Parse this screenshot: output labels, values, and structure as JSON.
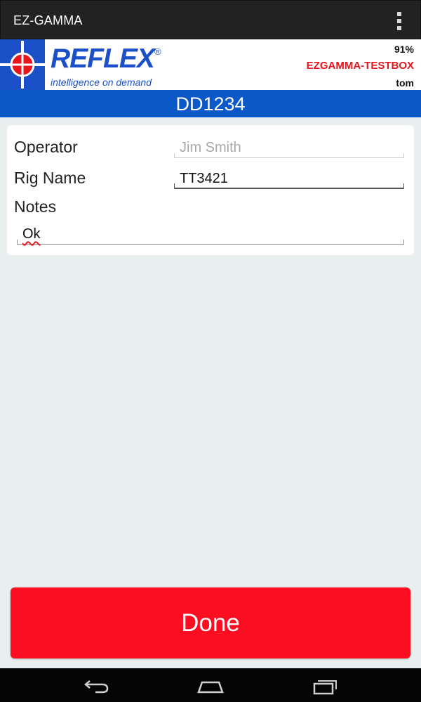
{
  "app": {
    "title": "EZ-GAMMA",
    "overflow_icon": "overflow-menu-icon"
  },
  "header": {
    "logo": {
      "word": "REFLEX",
      "registered": "®",
      "tagline": "intelligence on demand",
      "color": "#1b50c8"
    },
    "battery": "91%",
    "device": "EZGAMMA-TESTBOX",
    "user": "tom",
    "device_color": "#e8141c"
  },
  "hole_id": "DD1234",
  "form": {
    "operator_label": "Operator",
    "operator_value": "Jim Smith",
    "rig_label": "Rig Name",
    "rig_value": "TT3421",
    "notes_label": "Notes",
    "notes_value": "Ok"
  },
  "done_label": "Done",
  "colors": {
    "accent_blue": "#0b58c8",
    "done_red": "#fc0e22",
    "action_bar": "#222222"
  },
  "navbar": {
    "icons": [
      "back-icon",
      "home-icon",
      "recent-apps-icon"
    ]
  }
}
